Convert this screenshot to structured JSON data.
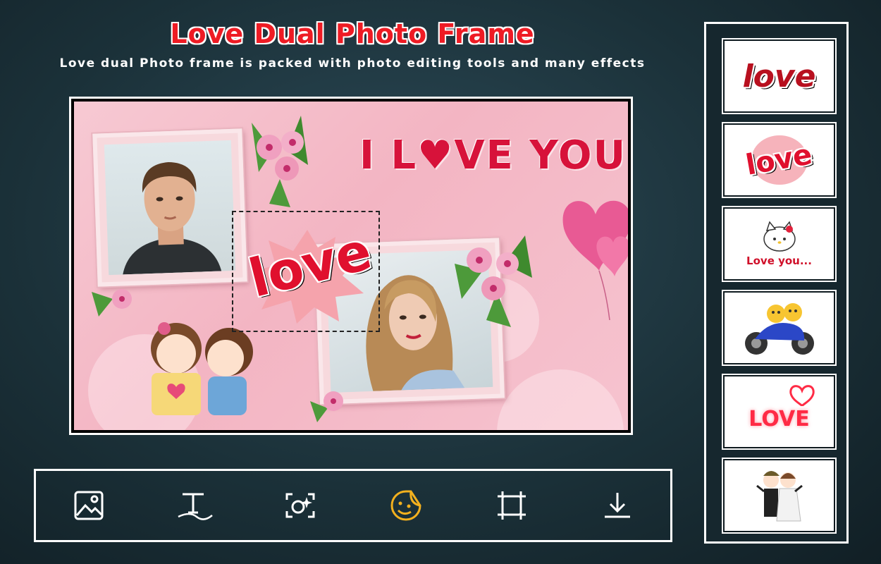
{
  "header": {
    "title": "Love Dual Photo Frame",
    "subtitle": "Love dual Photo frame is packed with photo editing tools and many effects"
  },
  "canvas": {
    "headline": "I L♥VE YOU",
    "sticker_text": "love"
  },
  "toolbar": {
    "tools": [
      {
        "name": "gallery-icon"
      },
      {
        "name": "text-icon"
      },
      {
        "name": "effects-icon"
      },
      {
        "name": "sticker-icon",
        "active": true
      },
      {
        "name": "crop-icon"
      },
      {
        "name": "download-icon"
      }
    ],
    "active_color": "#f2b01e",
    "icon_color": "#ffffff"
  },
  "sticker_panel": {
    "items": [
      {
        "label": "love"
      },
      {
        "label": "love"
      },
      {
        "label": "Love you..."
      },
      {
        "label": ""
      },
      {
        "label": "LOVE"
      },
      {
        "label": ""
      }
    ]
  },
  "colors": {
    "title": "#ee1b24",
    "background": "#1b3139",
    "canvas_pink": "#f3b5c3"
  }
}
